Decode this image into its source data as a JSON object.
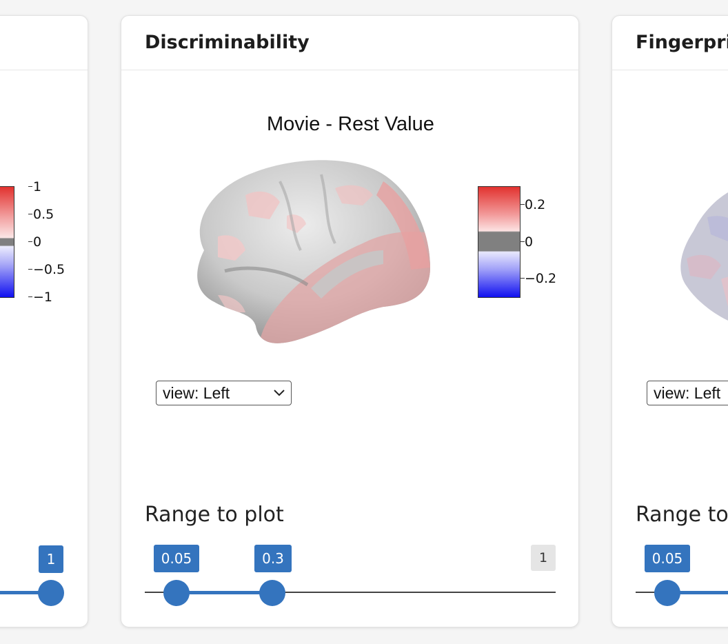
{
  "left_card": {
    "colorbar_ticks": [
      "1",
      "0.5",
      "0",
      "−0.5",
      "−1"
    ],
    "slider_max_badge": "1"
  },
  "center_card": {
    "title": "Discriminability",
    "plot_title": "Movie - Rest Value",
    "colorbar_ticks": [
      "0.2",
      "0",
      "−0.2"
    ],
    "view_select": "view: Left",
    "range_label": "Range to plot",
    "slider": {
      "low": "0.05",
      "high": "0.3",
      "max": "1",
      "low_value": 0.05,
      "high_value": 0.3,
      "range_max": 1
    }
  },
  "right_card": {
    "title": "Fingerprin",
    "view_select": "view: Left",
    "range_label": "Range to",
    "slider_low": "0.05"
  },
  "colors": {
    "accent": "#3474be",
    "colorbar_high": "#e2322f",
    "colorbar_low": "#1010f0",
    "colorbar_zero": "#808080"
  }
}
